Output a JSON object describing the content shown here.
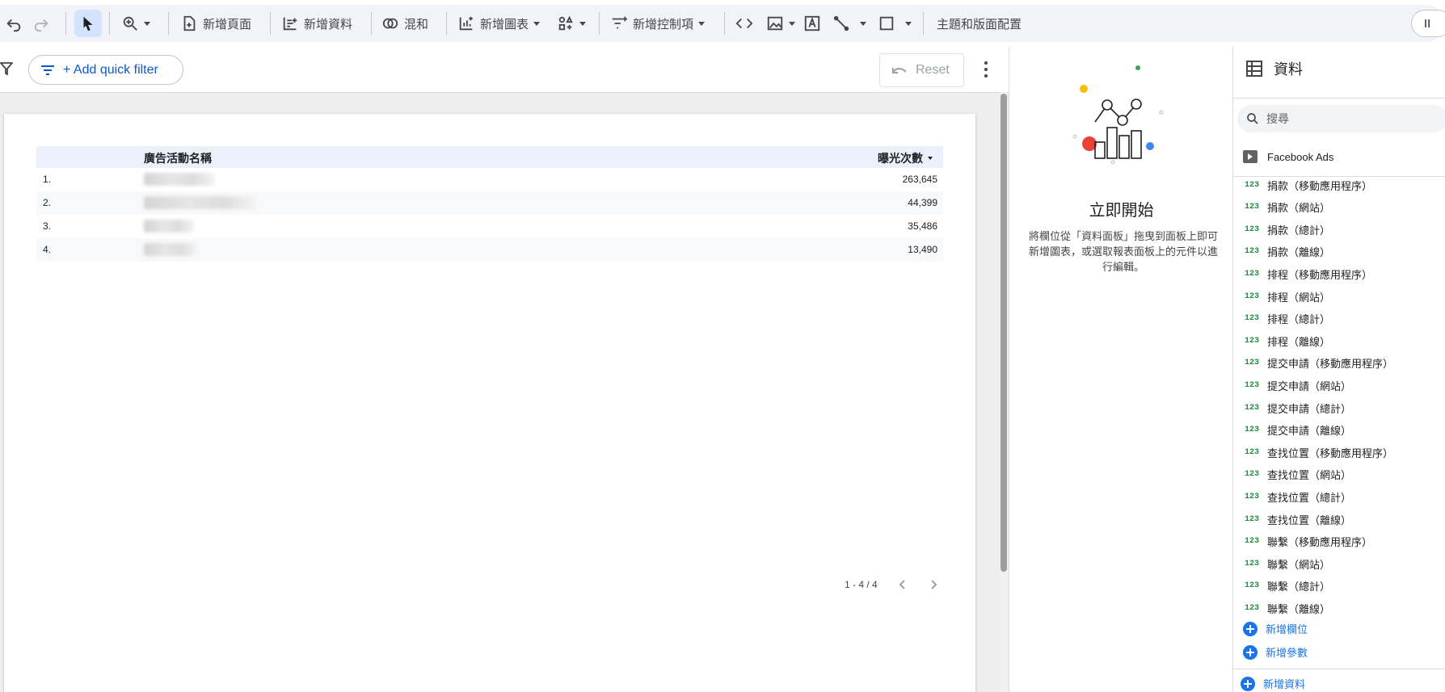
{
  "toolbar": {
    "add_page": "新增頁面",
    "add_data": "新增資料",
    "blend": "混和",
    "add_chart": "新增圖表",
    "add_control": "新增控制項",
    "theme_layout": "主題和版面配置"
  },
  "filter_bar": {
    "quick_filter": "+ Add quick filter",
    "reset": "Reset"
  },
  "table": {
    "headers": {
      "name": "廣告活動名稱",
      "value": "曝光次數"
    },
    "rows": [
      {
        "index": "1.",
        "value": "263,645"
      },
      {
        "index": "2.",
        "value": "44,399"
      },
      {
        "index": "3.",
        "value": "35,486"
      },
      {
        "index": "4.",
        "value": "13,490"
      }
    ],
    "pagination": "1 - 4 / 4"
  },
  "get_started": {
    "title": "立即開始",
    "description": "將欄位從「資料面板」拖曳到面板上即可新增圖表，或選取報表面板上的元件以進行編輯。"
  },
  "data_panel": {
    "title": "資料",
    "search_placeholder": "搜尋",
    "source": "Facebook Ads",
    "field_type_label": "123",
    "fields": [
      "捐款（移動應用程序）",
      "捐款（網站）",
      "捐款（總計）",
      "捐款（離線）",
      "排程（移動應用程序）",
      "排程（網站）",
      "排程（總計）",
      "排程（離線）",
      "提交申請（移動應用程序）",
      "提交申請（網站）",
      "提交申請（總計）",
      "提交申請（離線）",
      "查找位置（移動應用程序）",
      "查找位置（網站）",
      "查找位置（總計）",
      "查找位置（離線）",
      "聯繫（移動應用程序）",
      "聯繫（網站）",
      "聯繫（總計）",
      "聯繫（離線）"
    ],
    "add_field": "新增欄位",
    "add_parameter": "新增參數",
    "add_data": "新增資料"
  }
}
